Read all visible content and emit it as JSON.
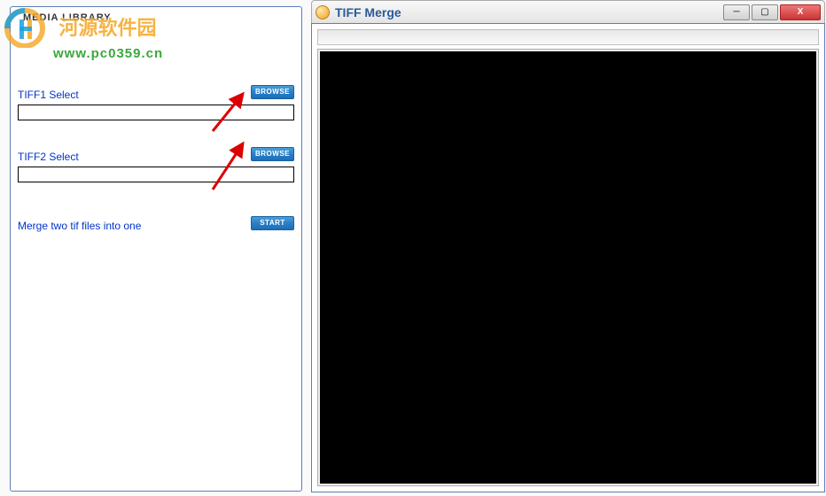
{
  "watermark": {
    "title": "河源软件园",
    "url": "www.pc0359.cn"
  },
  "leftPanel": {
    "title": "MEDIA LIBRARY",
    "tiff1": {
      "label": "TIFF1 Select",
      "browse": "BROWSE",
      "value": ""
    },
    "tiff2": {
      "label": "TIFF2 Select",
      "browse": "BROWSE",
      "value": ""
    },
    "merge": {
      "label": "Merge two tif files into one",
      "start": "START"
    }
  },
  "rightPanel": {
    "title": "TIFF Merge",
    "controls": {
      "minimize": "─",
      "maximize": "▢",
      "close": "X"
    }
  }
}
